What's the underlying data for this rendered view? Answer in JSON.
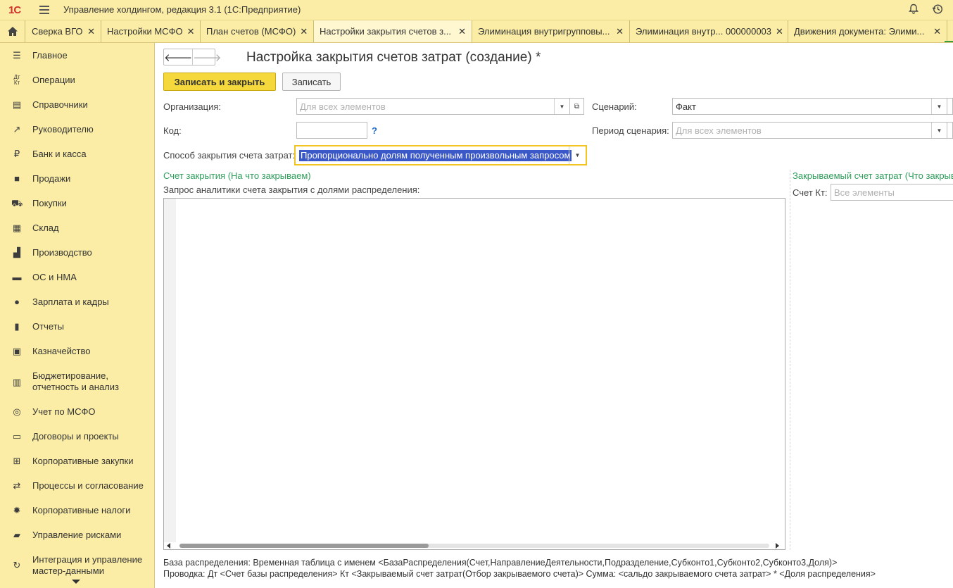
{
  "app": {
    "logo": "1С",
    "title": "Управление холдингом, редакция 3.1  (1С:Предприятие)",
    "icons": [
      "bell-icon",
      "history-icon"
    ]
  },
  "tabs": [
    {
      "label": "Сверка ВГО"
    },
    {
      "label": "Настройки МСФО"
    },
    {
      "label": "План счетов (МСФО)"
    },
    {
      "label": "Настройки закрытия счетов з..."
    },
    {
      "label": "Элиминация внутригрупповы..."
    },
    {
      "label": "Элиминация внутр... 000000003"
    },
    {
      "label": "Движения документа: Элими..."
    }
  ],
  "sidebar": {
    "items": [
      {
        "label": "Главное",
        "icon": "menu-icon"
      },
      {
        "label": "Операции",
        "icon": "dt-kt-icon"
      },
      {
        "label": "Справочники",
        "icon": "books-icon"
      },
      {
        "label": "Руководителю",
        "icon": "trend-icon"
      },
      {
        "label": "Банк и касса",
        "icon": "ruble-icon"
      },
      {
        "label": "Продажи",
        "icon": "bag-icon"
      },
      {
        "label": "Покупки",
        "icon": "cart-icon"
      },
      {
        "label": "Склад",
        "icon": "warehouse-icon"
      },
      {
        "label": "Производство",
        "icon": "factory-icon"
      },
      {
        "label": "ОС и НМА",
        "icon": "truck-icon"
      },
      {
        "label": "Зарплата и кадры",
        "icon": "person-icon"
      },
      {
        "label": "Отчеты",
        "icon": "bar-chart-icon"
      },
      {
        "label": "Казначейство",
        "icon": "money-icon"
      },
      {
        "label": "Бюджетирование, отчетность и анализ",
        "icon": "budget-icon"
      },
      {
        "label": "Учет по МСФО",
        "icon": "globe-icon"
      },
      {
        "label": "Договоры и проекты",
        "icon": "briefcase-icon"
      },
      {
        "label": "Корпоративные закупки",
        "icon": "gift-icon"
      },
      {
        "label": "Процессы и согласование",
        "icon": "process-icon"
      },
      {
        "label": "Корпоративные налоги",
        "icon": "gear-icon"
      },
      {
        "label": "Управление рисками",
        "icon": "risk-icon"
      },
      {
        "label": "Интеграция и управление мастер-данными",
        "icon": "sync-icon"
      }
    ]
  },
  "form": {
    "title": "Настройка закрытия счетов затрат (создание) *",
    "save_close_label": "Записать и закрыть",
    "save_label": "Записать",
    "organization_label": "Организация:",
    "organization_placeholder": "Для всех элементов",
    "scenario_label": "Сценарий:",
    "scenario_value": "Факт",
    "code_label": "Код:",
    "code_value": "",
    "help": "?",
    "scenario_period_label": "Период сценария:",
    "scenario_period_placeholder": "Для всех элементов",
    "method_label": "Способ закрытия счета затрат:",
    "method_value": "Пропорционально долям полученным произвольным запросом",
    "closing_account_header": "Счет закрытия (На что закрываем)",
    "query_label": "Запрос аналитики счета закрытия с долями распределения:",
    "query_text": "",
    "closed_account_header": "Закрываемый счет затрат (Что закрыв",
    "account_kt_label": "Счет Кт:",
    "account_kt_placeholder": "Все элементы",
    "scroll_position": 0.0,
    "note1": "База распределения: Временная таблица с именем <БазаРаспределения(Счет,НаправлениеДеятельности,Подразделение,Субконто1,Субконто2,Субконто3,Доля)>",
    "note2": "Проводка: Дт <Счет базы распределения> Кт <Закрываемый счет затрат(Отбор закрываемого счета)> Сумма: <сальдо закрываемого счета затрат> * <Доля распределения>"
  },
  "colors": {
    "chrome": "#fbeda5",
    "primary_button": "#f5d83c",
    "section_header": "#2f9e5a",
    "selection": "#3b58c8",
    "focus_border": "#f3c420"
  }
}
